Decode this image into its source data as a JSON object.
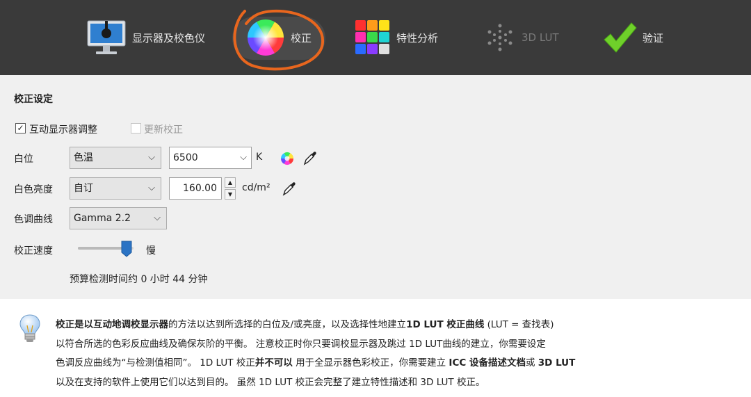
{
  "toolbar": {
    "items": [
      {
        "label": "显示器及校色仪",
        "icon": "monitor-icon"
      },
      {
        "label": "校正",
        "icon": "color-wheel-icon",
        "active": true
      },
      {
        "label": "特性分析",
        "icon": "color-grid-icon"
      },
      {
        "label": "3D LUT",
        "icon": "3d-lut-icon",
        "disabled": true
      },
      {
        "label": "验证",
        "icon": "checkmark-icon"
      }
    ]
  },
  "settings": {
    "title": "校正设定",
    "interactive_adjust": {
      "label": "互动显示器调整",
      "checked": true
    },
    "update_calibration": {
      "label": "更新校正",
      "checked": false,
      "disabled": true
    },
    "whitepoint": {
      "label": "白位",
      "mode": "色温",
      "value": "6500",
      "unit": "K"
    },
    "white_luminance": {
      "label": "白色亮度",
      "mode": "自订",
      "value": "160.00",
      "unit": "cd/m²"
    },
    "tone_curve": {
      "label": "色调曲线",
      "value": "Gamma 2.2"
    },
    "speed": {
      "label": "校正速度",
      "value_label": "慢",
      "level": 0.9
    },
    "estimate": "预算检测时间约 0 小时 44 分钟"
  },
  "info": {
    "line1": [
      "校正是以",
      "互动地调校显示器",
      "的方法以达到所选择的白位及/或亮度，以及选择性地建立",
      "1D LUT 校正曲线",
      " (LUT = 查找表)"
    ],
    "line2": "以符合所选的色彩反应曲线及确保灰阶的平衡。 注意校正时你只要调校显示器及跳过 1D LUT曲线的建立，你需要设定",
    "line3": [
      "色调反应曲线为“与检测值相同”。 1D LUT 校正",
      "并不可以",
      " 用于全显示器色彩校正，你需要建立 ",
      "ICC 设备描述文档",
      "或 ",
      "3D LUT"
    ],
    "line4": "以及在支持的软件上使用它们以达到目的。 虽然 1D LUT 校正会完整了建立特性描述和 3D LUT 校正。"
  },
  "colors": {
    "toolbar_bg": "#3a3a3a",
    "annotation": "#e8661e",
    "accent_blue": "#2b73c4"
  }
}
